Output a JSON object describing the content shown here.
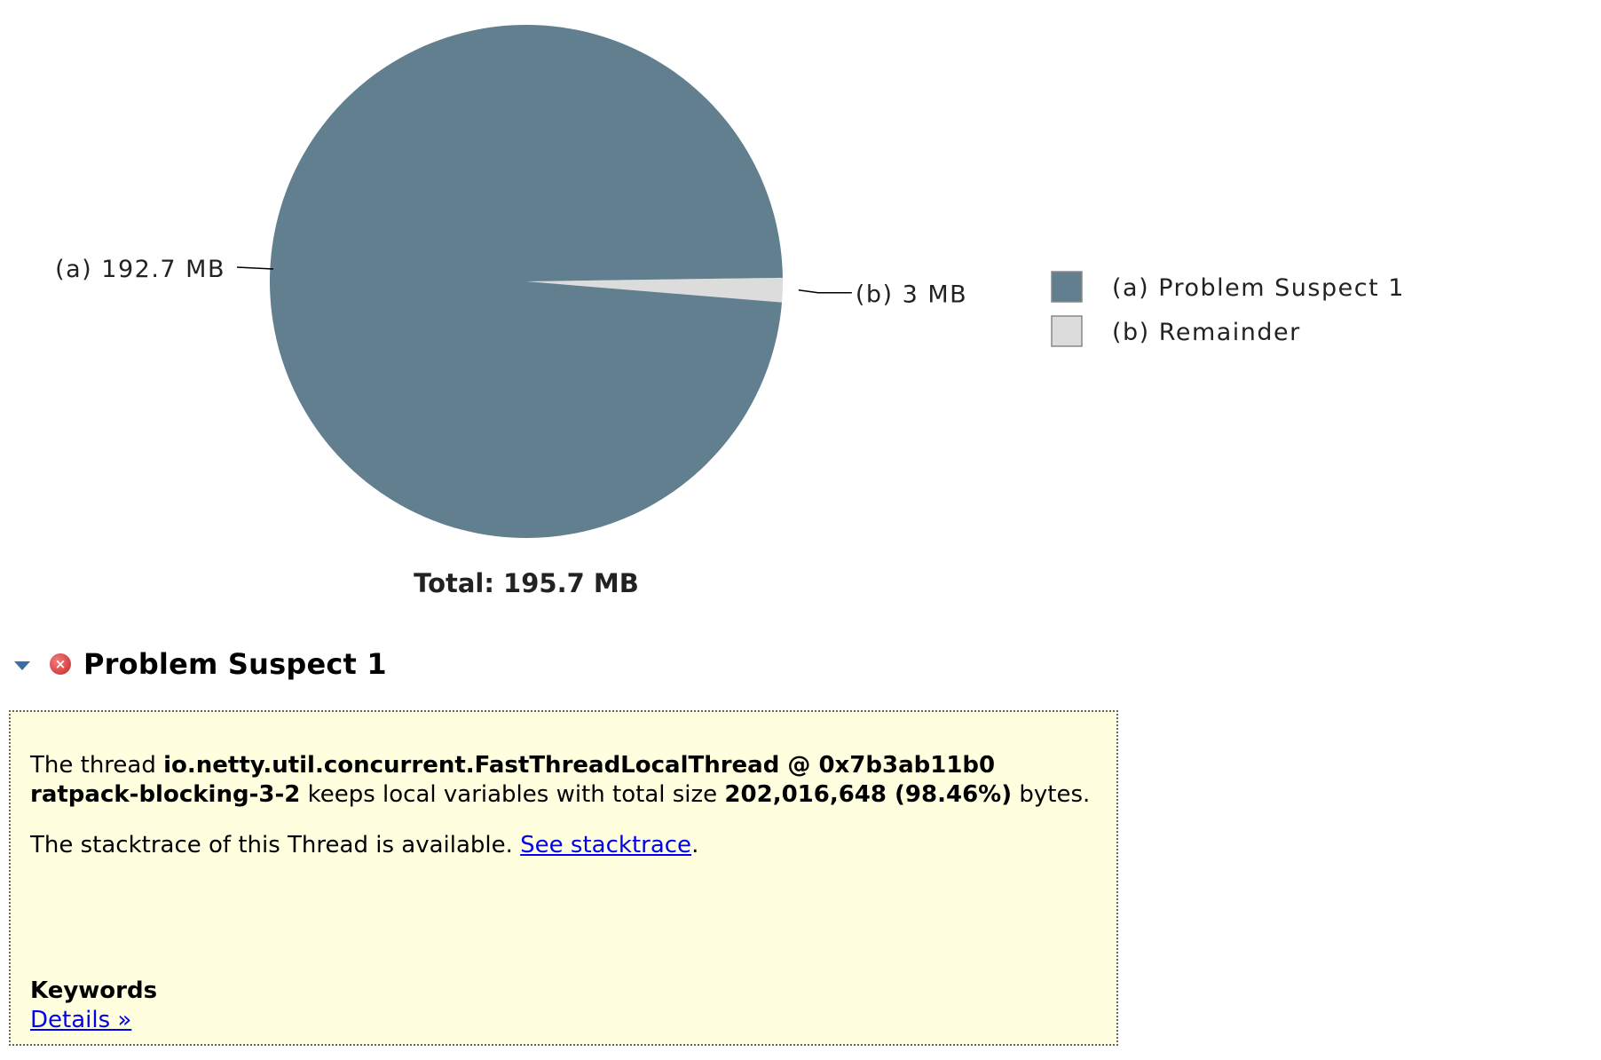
{
  "chart_data": {
    "type": "pie",
    "slices": [
      {
        "id": "a",
        "name": "Problem Suspect 1",
        "value": 192.7,
        "label": "(a)  192.7 MB",
        "legend": "(a)  Problem Suspect 1",
        "color": "#627f8f"
      },
      {
        "id": "b",
        "name": "Remainder",
        "value": 3,
        "label": "(b)  3 MB",
        "legend": "(b)  Remainder",
        "color": "#dcdcdc"
      }
    ],
    "unit": "MB",
    "total_label": "Total: 195.7 MB",
    "legend_position": "right"
  },
  "suspect": {
    "title": "Problem Suspect 1",
    "error_glyph": "×",
    "p1_prefix": "The thread ",
    "thread_name": "io.netty.util.concurrent.FastThreadLocalThread @ 0x7b3ab11b0 ratpack-blocking-3-2",
    "p1_mid": " keeps local variables with total size ",
    "size": "202,016,648 (98.46%)",
    "p1_suffix": " bytes.",
    "p2_prefix": "The stacktrace of this Thread is available. ",
    "stacktrace_link": "See stacktrace",
    "p2_suffix": ".",
    "keywords_title": "Keywords",
    "details_link": "Details »"
  }
}
